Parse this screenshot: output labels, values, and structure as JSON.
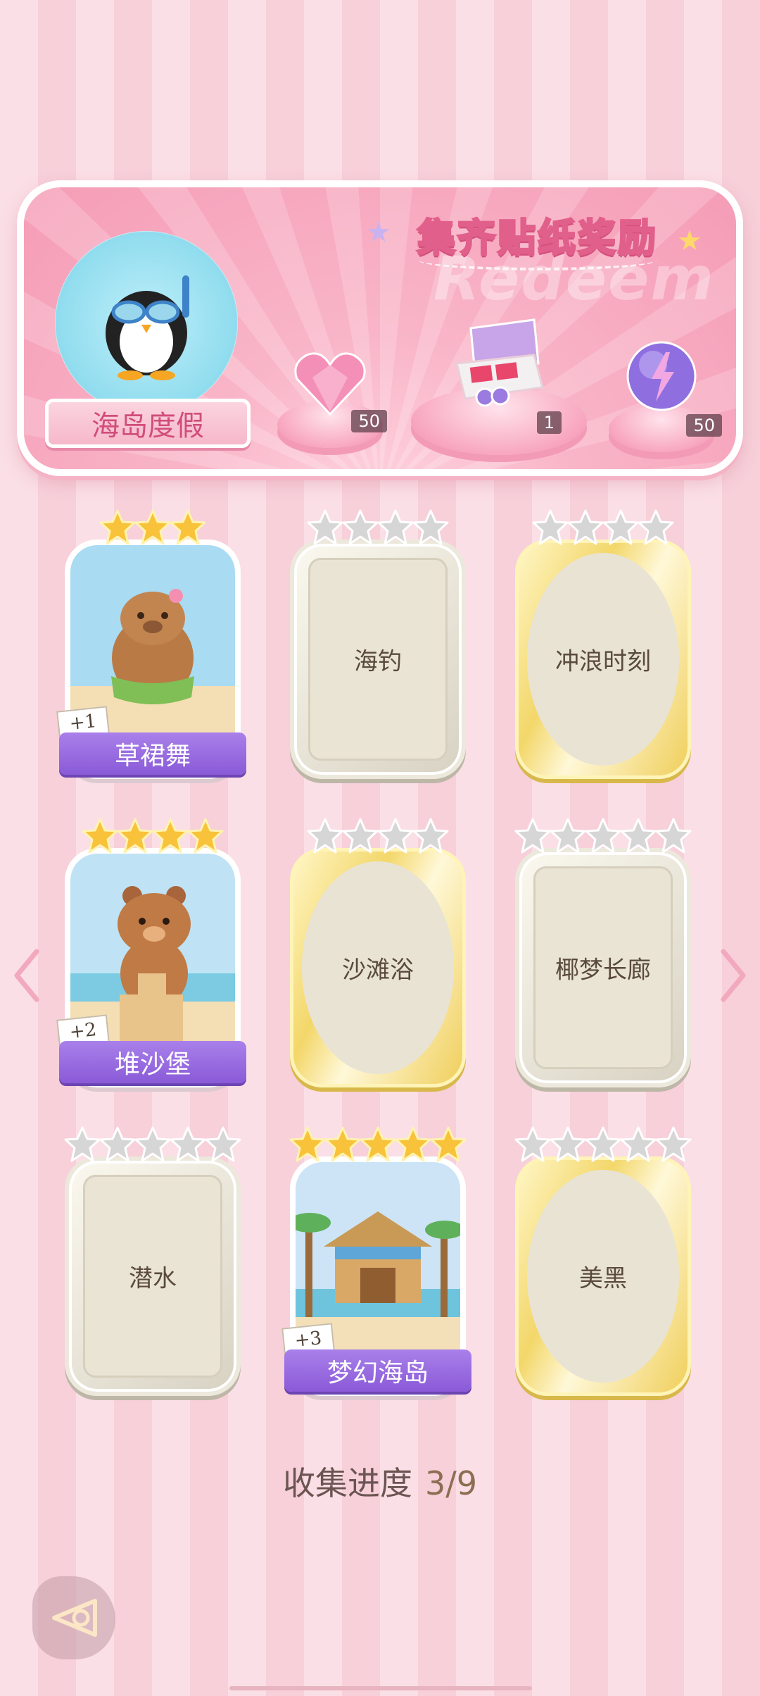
{
  "banner": {
    "title": "集齐贴纸奖励",
    "watermark": "Redeem",
    "theme_name": "海岛度假",
    "rewards": [
      {
        "icon": "pink-heart-gem-icon",
        "qty": "50"
      },
      {
        "icon": "gift-box-icon",
        "qty": "1"
      },
      {
        "icon": "purple-energy-orb-icon",
        "qty": "50"
      }
    ]
  },
  "stickers": [
    {
      "name": "草裙舞",
      "state": "collected",
      "stars": 3,
      "star_color": "gold",
      "count": "+1",
      "art": "capybara-hula-art"
    },
    {
      "name": "海钓",
      "state": "locked",
      "frame": "silver",
      "stars": 4,
      "star_color": "silver"
    },
    {
      "name": "冲浪时刻",
      "state": "locked",
      "frame": "gold",
      "stars": 4,
      "star_color": "silver"
    },
    {
      "name": "堆沙堡",
      "state": "collected",
      "stars": 4,
      "star_color": "gold",
      "count": "+2",
      "art": "bear-sandcastle-art"
    },
    {
      "name": "沙滩浴",
      "state": "locked",
      "frame": "gold",
      "stars": 4,
      "star_color": "silver"
    },
    {
      "name": "椰梦长廊",
      "state": "locked",
      "frame": "silver",
      "stars": 5,
      "star_color": "silver"
    },
    {
      "name": "潜水",
      "state": "locked",
      "frame": "silver",
      "stars": 5,
      "star_color": "silver"
    },
    {
      "name": "梦幻海岛",
      "state": "collected",
      "stars": 5,
      "star_color": "gold",
      "count": "+3",
      "art": "beach-hut-art"
    },
    {
      "name": "美黑",
      "state": "locked",
      "frame": "gold",
      "stars": 5,
      "star_color": "silver"
    }
  ],
  "progress": {
    "label": "收集进度",
    "value": "3/9"
  },
  "nav": {
    "prev": "chevron-left-icon",
    "next": "chevron-right-icon",
    "back": "back-arrow-icon"
  },
  "colors": {
    "accent_pink": "#e15f8b",
    "banner_purple": "#8a5ad8",
    "gold_star": "#f8c23a",
    "silver_star": "#cfcfcf"
  }
}
